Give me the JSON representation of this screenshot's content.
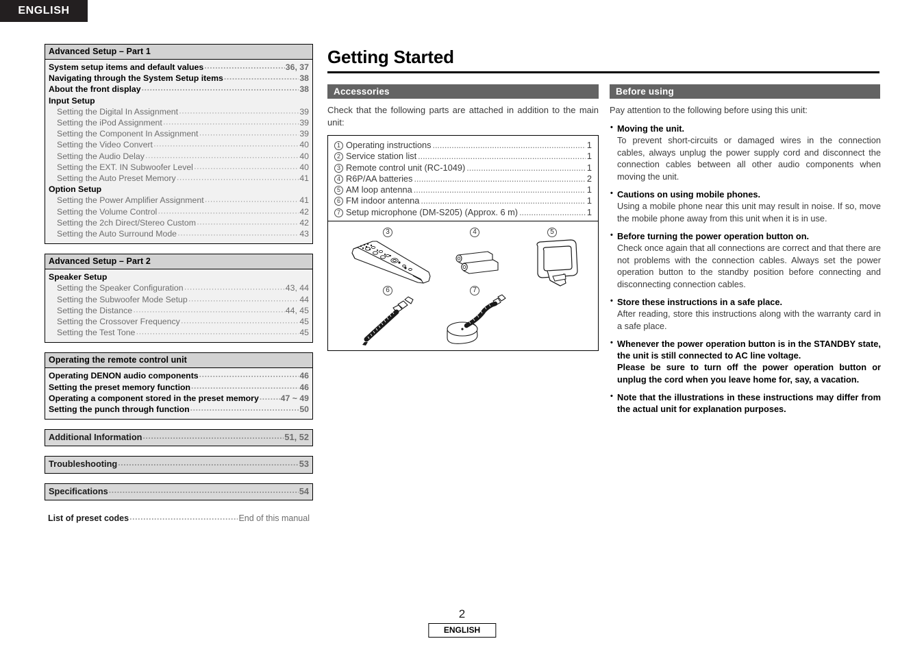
{
  "header": {
    "language_tab": "ENGLISH"
  },
  "footer": {
    "page_number": "2",
    "badge": "ENGLISH"
  },
  "toc": {
    "blocks": [
      {
        "title": "Advanced Setup – Part 1",
        "entries": [
          {
            "level": 0,
            "text": "System setup items and default values",
            "page": "36, 37"
          },
          {
            "level": 0,
            "text": "Navigating through the System Setup items",
            "page": "38"
          },
          {
            "level": 0,
            "text": "About the front display",
            "page": "38"
          },
          {
            "level": "group",
            "text": "Input Setup",
            "page": ""
          },
          {
            "level": 1,
            "text": "Setting the Digital In Assignment",
            "page": "39"
          },
          {
            "level": 1,
            "text": "Setting the iPod Assignment",
            "page": "39"
          },
          {
            "level": 1,
            "text": "Setting the Component In Assignment",
            "page": "39"
          },
          {
            "level": 1,
            "text": "Setting the Video Convert",
            "page": "40"
          },
          {
            "level": 1,
            "text": "Setting the Audio Delay",
            "page": "40"
          },
          {
            "level": 1,
            "text": "Setting the EXT. IN Subwoofer Level",
            "page": "40"
          },
          {
            "level": 1,
            "text": "Setting the Auto Preset Memory",
            "page": "41"
          },
          {
            "level": "group",
            "text": "Option Setup",
            "page": ""
          },
          {
            "level": 1,
            "text": "Setting the Power Amplifier Assignment",
            "page": "41"
          },
          {
            "level": 1,
            "text": "Setting the Volume Control",
            "page": "42"
          },
          {
            "level": 1,
            "text": "Setting the 2ch Direct/Stereo Custom",
            "page": "42"
          },
          {
            "level": 1,
            "text": "Setting the Auto Surround Mode",
            "page": "43"
          }
        ]
      },
      {
        "title": "Advanced Setup – Part 2",
        "entries": [
          {
            "level": "group",
            "text": "Speaker Setup",
            "page": ""
          },
          {
            "level": 1,
            "text": "Setting the Speaker Configuration",
            "page": "43, 44"
          },
          {
            "level": 1,
            "text": "Setting the Subwoofer Mode Setup",
            "page": "44"
          },
          {
            "level": 1,
            "text": "Setting the Distance",
            "page": "44, 45"
          },
          {
            "level": 1,
            "text": "Setting the Crossover Frequency",
            "page": "45"
          },
          {
            "level": 1,
            "text": "Setting the Test Tone",
            "page": "45"
          }
        ]
      },
      {
        "title": "Operating the remote control unit",
        "entries": [
          {
            "level": 0,
            "text": "Operating DENON audio components",
            "page": "46"
          },
          {
            "level": 0,
            "text": "Setting the preset memory function",
            "page": "46"
          },
          {
            "level": 0,
            "text": "Operating a component stored in the preset memory",
            "page": "47 ~ 49"
          },
          {
            "level": 0,
            "text": "Setting the punch through function",
            "page": "50"
          }
        ]
      }
    ],
    "singles": [
      {
        "text": "Additional Information",
        "page": "51, 52"
      },
      {
        "text": "Troubleshooting",
        "page": "53"
      },
      {
        "text": "Specifications",
        "page": "54"
      }
    ],
    "plain": {
      "text": "List of preset codes",
      "page": "End of this manual"
    }
  },
  "main": {
    "title": "Getting Started",
    "accessories": {
      "bar_label": "Accessories",
      "intro": "Check that the following parts are attached in addition to the main unit:",
      "items": [
        {
          "num": "1",
          "text": "Operating instructions",
          "qty": "1"
        },
        {
          "num": "2",
          "text": "Service station list",
          "qty": "1"
        },
        {
          "num": "3",
          "text": "Remote control unit (RC-1049)",
          "qty": "1"
        },
        {
          "num": "4",
          "text": "R6P/AA batteries",
          "qty": "2"
        },
        {
          "num": "5",
          "text": "AM loop antenna",
          "qty": "1"
        },
        {
          "num": "6",
          "text": "FM indoor antenna",
          "qty": "1"
        },
        {
          "num": "7",
          "text": "Setup microphone (DM-S205) (Approx. 6 m)",
          "qty": "1"
        }
      ],
      "figures": [
        {
          "num": "3",
          "icon": "remote-control-illustration"
        },
        {
          "num": "4",
          "icon": "batteries-illustration"
        },
        {
          "num": "5",
          "icon": "am-loop-antenna-illustration"
        },
        {
          "num": "6",
          "icon": "fm-indoor-antenna-illustration"
        },
        {
          "num": "7",
          "icon": "setup-microphone-illustration"
        }
      ]
    },
    "before_using": {
      "bar_label": "Before using",
      "intro": "Pay attention to the following before using this unit:",
      "items": [
        {
          "head": "Moving the unit.",
          "body": "To prevent short-circuits or damaged wires in the connection cables, always unplug the power supply cord and disconnect the connection cables between all other audio components when moving the unit.",
          "bold_body": false
        },
        {
          "head": "Cautions on using mobile phones.",
          "body": "Using a mobile phone near this unit may result in noise. If so, move the mobile phone away from this unit when it is in use.",
          "bold_body": false
        },
        {
          "head": "Before turning the power operation button on.",
          "body": "Check once again that all connections are correct and that there are not problems with the connection cables. Always set the power operation button to the standby position before connecting and disconnecting connection cables.",
          "bold_body": false
        },
        {
          "head": "Store these instructions in a safe place.",
          "body": "After reading, store this instructions along with the warranty card in a safe place.",
          "bold_body": false
        },
        {
          "head": "Whenever the power operation button is in the STANDBY state, the unit is still connected to AC line voltage.",
          "body": "Please be sure to turn off the power operation button or unplug the cord when you leave home for, say, a vacation.",
          "bold_body": true
        },
        {
          "head": "Note that the illustrations in these instructions may differ from the actual unit for explanation purposes.",
          "body": "",
          "bold_body": true
        }
      ]
    }
  },
  "colors": {
    "tab_background": "#231f20",
    "section_bar": "#636363",
    "toc_head_background": "#d2d2d2",
    "toc_body_background": "#f1f1f1",
    "toc_single_background": "#d8d8d8",
    "text": "#1a1a1a"
  }
}
